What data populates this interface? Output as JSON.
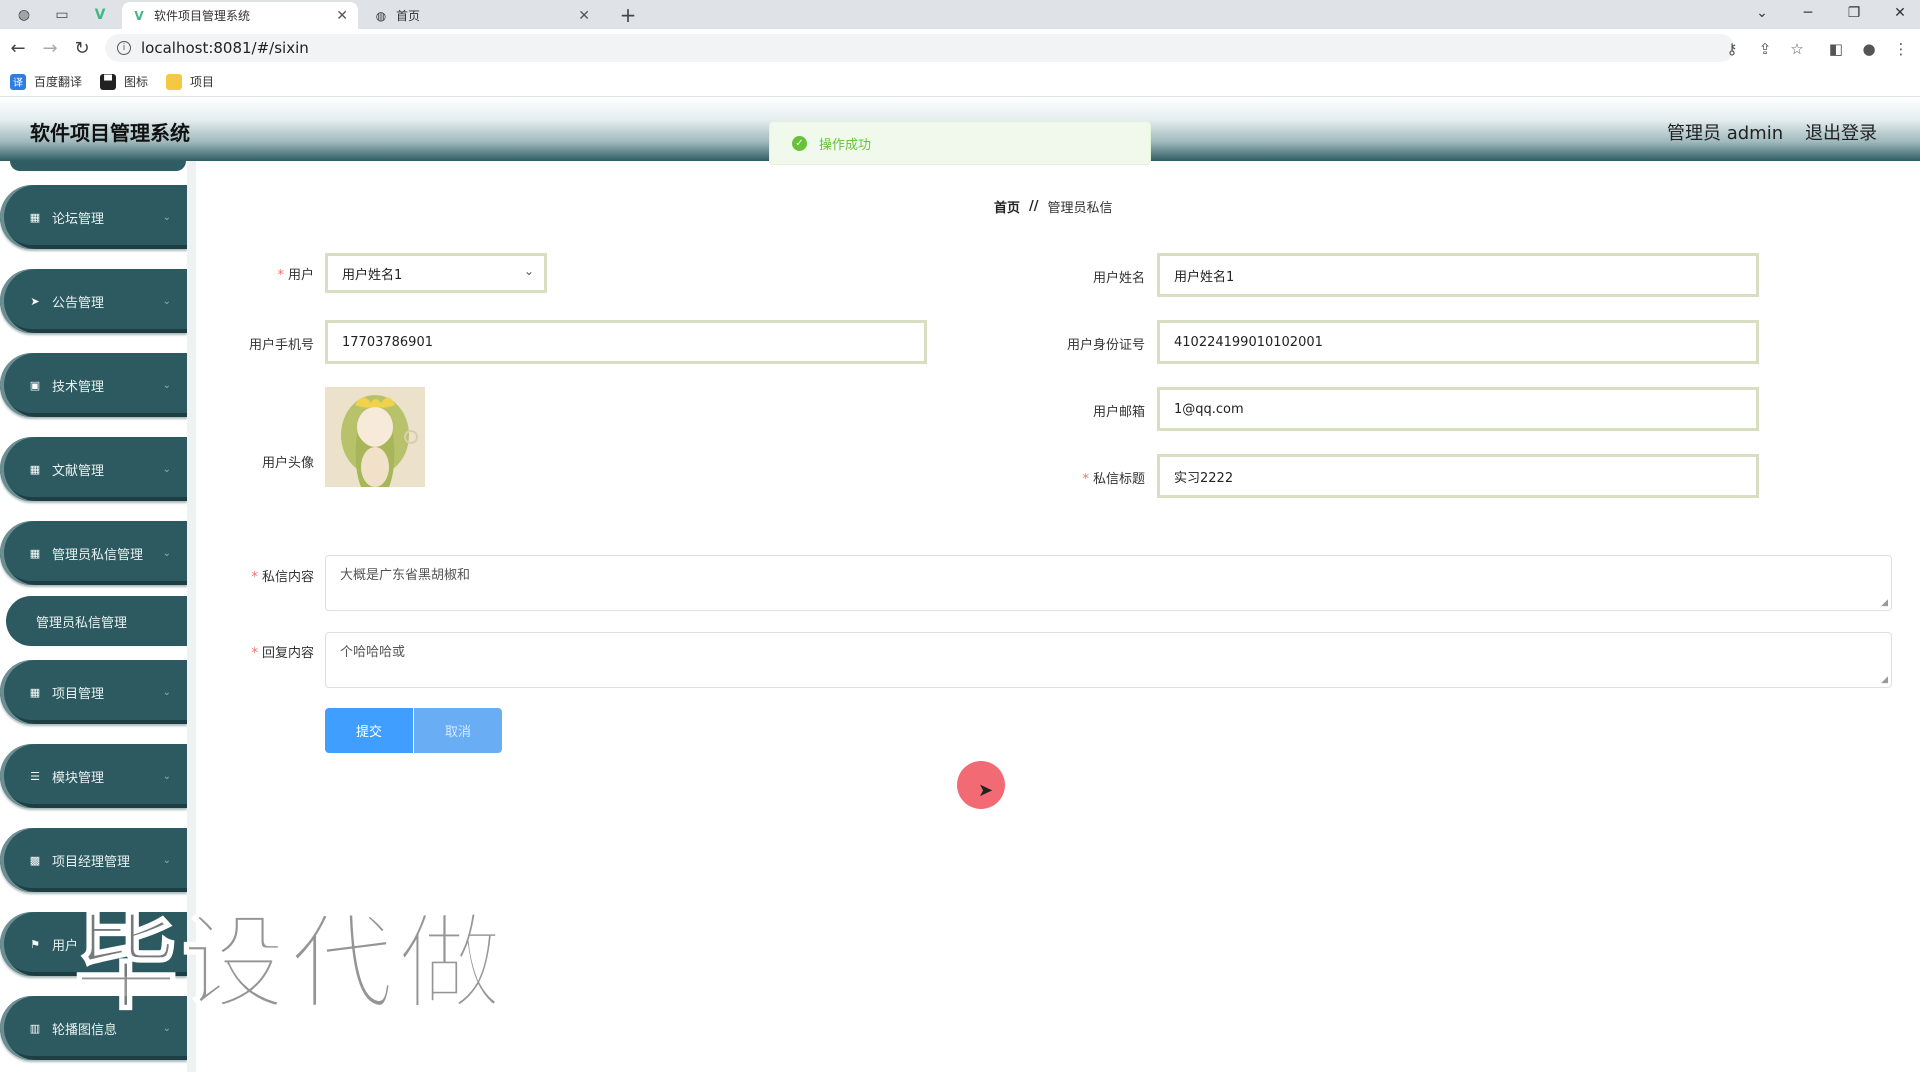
{
  "browser": {
    "tabs": [
      {
        "title": "软件项目管理系统",
        "active": true
      },
      {
        "title": "首页",
        "active": false
      }
    ],
    "url": "localhost:8081/#/sixin",
    "bookmarks": [
      {
        "label": "百度翻译",
        "icon": "translate-icon"
      },
      {
        "label": "图标",
        "icon": "folder-dark-icon"
      },
      {
        "label": "项目",
        "icon": "folder-icon"
      }
    ]
  },
  "header": {
    "title": "软件项目管理系统",
    "admin_label": "管理员 admin",
    "logout_label": "退出登录"
  },
  "toast": {
    "message": "操作成功",
    "color": "#67c23a"
  },
  "sidebar": {
    "items": [
      {
        "label": "论坛管理",
        "icon": "grid-icon"
      },
      {
        "label": "公告管理",
        "icon": "send-icon"
      },
      {
        "label": "技术管理",
        "icon": "clipboard-icon"
      },
      {
        "label": "文献管理",
        "icon": "grid-icon"
      },
      {
        "label": "管理员私信管理",
        "icon": "grid-icon"
      },
      {
        "label": "项目管理",
        "icon": "grid-icon"
      },
      {
        "label": "模块管理",
        "icon": "sliders-icon"
      },
      {
        "label": "项目经理管理",
        "icon": "apps-icon"
      },
      {
        "label": "用户",
        "icon": "flag-icon"
      },
      {
        "label": "轮播图信息",
        "icon": "chart-icon"
      }
    ],
    "submenu": {
      "label": "管理员私信管理"
    },
    "bg_color": "#2c5a60"
  },
  "breadcrumb": {
    "home": "首页",
    "separator": "//",
    "current": "管理员私信"
  },
  "form": {
    "user": {
      "label": "用户",
      "value": "用户姓名1"
    },
    "user_name": {
      "label": "用户姓名",
      "value": "用户姓名1"
    },
    "phone": {
      "label": "用户手机号",
      "value": "17703786901"
    },
    "id_card": {
      "label": "用户身份证号",
      "value": "410224199010102001"
    },
    "avatar": {
      "label": "用户头像"
    },
    "email": {
      "label": "用户邮箱",
      "value": "1@qq.com"
    },
    "msg_title": {
      "label": "私信标题",
      "value": "实习2222"
    },
    "msg_content": {
      "label": "私信内容",
      "value": "大概是广东省黑胡椒和"
    },
    "reply": {
      "label": "回复内容",
      "value": "个哈哈哈或"
    },
    "submit_label": "提交",
    "cancel_label": "取消"
  },
  "watermark": "毕设代做",
  "accent_color": "#409eff"
}
